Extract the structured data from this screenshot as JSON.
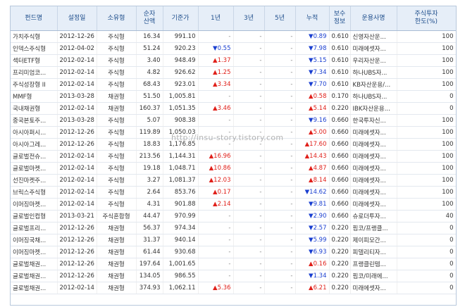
{
  "headers": [
    "펀드명",
    "설정일",
    "소유형",
    "순자\n산액",
    "기준가",
    "1년",
    "3년",
    "5년",
    "누적",
    "보수\n정보",
    "운용사명",
    "주식투자\n한도(%)"
  ],
  "rows": [
    {
      "name": "가치주식형",
      "date": "2012-12-26",
      "type": "주식형",
      "nav": "16.34",
      "price": "991.10",
      "y1": "-",
      "y1d": "",
      "y3": "-",
      "y5": "-",
      "cum": "0.89",
      "cumd": "down",
      "fee": "0.610",
      "mgr": "신영자산운...",
      "limit": "100"
    },
    {
      "name": "인덱스주식형",
      "date": "2012-04-02",
      "type": "주식형",
      "nav": "51.24",
      "price": "920.23",
      "y1": "0.55",
      "y1d": "down",
      "y3": "-",
      "y5": "-",
      "cum": "7.98",
      "cumd": "down",
      "fee": "0.610",
      "mgr": "미래에셋자...",
      "limit": "100"
    },
    {
      "name": "섹터ETF형",
      "date": "2012-02-14",
      "type": "주식형",
      "nav": "3.40",
      "price": "948.49",
      "y1": "1.37",
      "y1d": "up",
      "y3": "-",
      "y5": "-",
      "cum": "5.15",
      "cumd": "down",
      "fee": "0.610",
      "mgr": "우리자산운...",
      "limit": "100"
    },
    {
      "name": "프리미엄코...",
      "date": "2012-02-14",
      "type": "주식형",
      "nav": "4.82",
      "price": "926.62",
      "y1": "1.25",
      "y1d": "up",
      "y3": "-",
      "y5": "-",
      "cum": "7.34",
      "cumd": "down",
      "fee": "0.610",
      "mgr": "하나UBS자...",
      "limit": "100"
    },
    {
      "name": "주식성장형 II",
      "date": "2012-02-14",
      "type": "주식형",
      "nav": "68.43",
      "price": "923.01",
      "y1": "3.34",
      "y1d": "up",
      "y3": "-",
      "y5": "-",
      "cum": "7.70",
      "cumd": "down",
      "fee": "0.610",
      "mgr": "KB자산운용/...",
      "limit": "100"
    },
    {
      "name": "MMF형",
      "date": "2013-03-28",
      "type": "채권형",
      "nav": "51.50",
      "price": "1,005.81",
      "y1": "-",
      "y1d": "",
      "y3": "-",
      "y5": "-",
      "cum": "0.58",
      "cumd": "up",
      "fee": "0.170",
      "mgr": "하나UBS자...",
      "limit": "0"
    },
    {
      "name": "국내채권형",
      "date": "2012-02-14",
      "type": "채권형",
      "nav": "160.37",
      "price": "1,051.35",
      "y1": "3.46",
      "y1d": "up",
      "y3": "-",
      "y5": "-",
      "cum": "5.14",
      "cumd": "up",
      "fee": "0.220",
      "mgr": "IBK자산운용...",
      "limit": "0"
    },
    {
      "name": "중국본토주...",
      "date": "2013-03-28",
      "type": "주식형",
      "nav": "5.07",
      "price": "908.38",
      "y1": "-",
      "y1d": "",
      "y3": "-",
      "y5": "-",
      "cum": "9.16",
      "cumd": "down",
      "fee": "0.660",
      "mgr": "한국투자신...",
      "limit": "100"
    },
    {
      "name": "아시아퍼시...",
      "date": "2012-12-26",
      "type": "주식형",
      "nav": "119.89",
      "price": "1,050.03",
      "y1": "-",
      "y1d": "",
      "y3": "-",
      "y5": "-",
      "cum": "5.00",
      "cumd": "up",
      "fee": "0.660",
      "mgr": "미래에셋자...",
      "limit": "100"
    },
    {
      "name": "아시아그레...",
      "date": "2012-12-26",
      "type": "주식형",
      "nav": "18.83",
      "price": "1,176.85",
      "y1": "-",
      "y1d": "",
      "y3": "-",
      "y5": "-",
      "cum": "17.60",
      "cumd": "up",
      "fee": "0.660",
      "mgr": "미래에셋자...",
      "limit": "100"
    },
    {
      "name": "글로벌전슈...",
      "date": "2012-02-14",
      "type": "주식형",
      "nav": "213.56",
      "price": "1,144.31",
      "y1": "16.96",
      "y1d": "up",
      "y3": "-",
      "y5": "-",
      "cum": "14.43",
      "cumd": "up",
      "fee": "0.660",
      "mgr": "미래에셋자...",
      "limit": "100"
    },
    {
      "name": "글로벌마켓...",
      "date": "2012-02-14",
      "type": "주식형",
      "nav": "19.18",
      "price": "1,048.71",
      "y1": "10.86",
      "y1d": "up",
      "y3": "-",
      "y5": "-",
      "cum": "4.87",
      "cumd": "up",
      "fee": "0.660",
      "mgr": "미래에셋자...",
      "limit": "100"
    },
    {
      "name": "선진마켓주...",
      "date": "2012-02-14",
      "type": "주식형",
      "nav": "3.27",
      "price": "1,081.37",
      "y1": "12.03",
      "y1d": "up",
      "y3": "-",
      "y5": "-",
      "cum": "8.14",
      "cumd": "up",
      "fee": "0.660",
      "mgr": "미래에셋자...",
      "limit": "100"
    },
    {
      "name": "브릭스주식형",
      "date": "2012-02-14",
      "type": "주식형",
      "nav": "2.64",
      "price": "853.76",
      "y1": "0.17",
      "y1d": "up",
      "y3": "-",
      "y5": "-",
      "cum": "14.62",
      "cumd": "down",
      "fee": "0.660",
      "mgr": "미래에셋자...",
      "limit": "100"
    },
    {
      "name": "이머징마켓...",
      "date": "2012-02-14",
      "type": "주식형",
      "nav": "4.31",
      "price": "901.88",
      "y1": "2.14",
      "y1d": "up",
      "y3": "-",
      "y5": "-",
      "cum": "9.81",
      "cumd": "down",
      "fee": "0.660",
      "mgr": "미래에셋자...",
      "limit": "100"
    },
    {
      "name": "글로벌인컴형",
      "date": "2013-03-21",
      "type": "주식혼합형",
      "nav": "44.47",
      "price": "970.99",
      "y1": "-",
      "y1d": "",
      "y3": "-",
      "y5": "-",
      "cum": "2.90",
      "cumd": "down",
      "fee": "0.660",
      "mgr": "슈로더투자...",
      "limit": "40"
    },
    {
      "name": "글로벌프리...",
      "date": "2012-12-26",
      "type": "채권형",
      "nav": "56.37",
      "price": "974.34",
      "y1": "-",
      "y1d": "",
      "y3": "-",
      "y5": "-",
      "cum": "2.57",
      "cumd": "down",
      "fee": "0.220",
      "mgr": "핌코/프랭클...",
      "limit": "0"
    },
    {
      "name": "이머징국채...",
      "date": "2012-12-26",
      "type": "채권형",
      "nav": "31.37",
      "price": "940.14",
      "y1": "-",
      "y1d": "",
      "y3": "-",
      "y5": "-",
      "cum": "5.99",
      "cumd": "down",
      "fee": "0.220",
      "mgr": "제이피모간...",
      "limit": "0"
    },
    {
      "name": "이머징마켓...",
      "date": "2012-12-26",
      "type": "채권형",
      "nav": "61.44",
      "price": "930.68",
      "y1": "-",
      "y1d": "",
      "y3": "-",
      "y5": "-",
      "cum": "6.93",
      "cumd": "down",
      "fee": "0.220",
      "mgr": "피델리티자...",
      "limit": "0"
    },
    {
      "name": "글로벌채권...",
      "date": "2012-12-26",
      "type": "채권형",
      "nav": "197.64",
      "price": "1,001.65",
      "y1": "-",
      "y1d": "",
      "y3": "-",
      "y5": "-",
      "cum": "0.16",
      "cumd": "up",
      "fee": "0.220",
      "mgr": "프랭클린템...",
      "limit": "0"
    },
    {
      "name": "글로벌채권...",
      "date": "2012-12-26",
      "type": "채권형",
      "nav": "134.05",
      "price": "986.55",
      "y1": "-",
      "y1d": "",
      "y3": "-",
      "y5": "-",
      "cum": "1.34",
      "cumd": "down",
      "fee": "0.220",
      "mgr": "핌코/미래에...",
      "limit": "0"
    },
    {
      "name": "글로벌채권...",
      "date": "2012-02-14",
      "type": "채권형",
      "nav": "374.93",
      "price": "1,062.11",
      "y1": "5.36",
      "y1d": "up",
      "y3": "-",
      "y5": "-",
      "cum": "6.21",
      "cumd": "up",
      "fee": "0.220",
      "mgr": "미래에셋자...",
      "limit": "0"
    }
  ],
  "watermark": "http://insu-story.tistory.com",
  "colors": {
    "header_bg": "#e6eef8",
    "header_text": "#1f4e8c",
    "up": "#e0201a",
    "down": "#1a3fd0"
  }
}
